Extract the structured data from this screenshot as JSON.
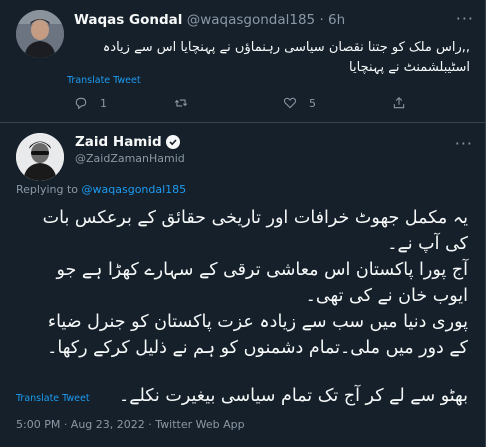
{
  "reply_tweet": {
    "name": "Waqas Gondal",
    "handle": "@waqasgondal185",
    "time": "· 6h",
    "text_line1": ",,راس ملک کو جتنا نقصان سیاسی رہنماؤں نے پہنچایا اس سے زیادہ",
    "text_line2": "اسٹیبلشمنٹ نے پہنچایا",
    "translate_label": "Translate Tweet",
    "reply_count": "1",
    "retweet_count": "",
    "like_count": "5",
    "more_icon": "more-dots"
  },
  "main_tweet": {
    "name": "Zaid Hamid",
    "handle": "@ZaidZamanHamid",
    "verified": true,
    "replying_prefix": "Replying to",
    "replying_to": "@waqasgondal185",
    "lines": [
      "یہ مکمل جھوٹ خرافات اور تاریخی حقائق کے برعکس بات",
      "کی آپ نے۔",
      "آج پورا پاکستان اس معاشی ترقی کے سہارے کھڑا ہے جو",
      "ایوب خان نے کی تھی۔",
      "پوری دنیا میں سب سے زیادہ عزت پاکستان کو جنرل ضیاء",
      "کے دور میں ملی۔تمام دشمنوں کو ہم نے ذلیل کرکے رکھا۔",
      "",
      "بھٹو سے لے کر آج تک تمام  سیاسی بیغیرت نکلے۔"
    ],
    "translate_label": "Translate Tweet",
    "timestamp": "5:00 PM · Aug 23, 2022 · Twitter Web App"
  },
  "colors": {
    "background": "#15202b",
    "border": "#38444d",
    "text": "#f7f9f9",
    "muted": "#8b98a5",
    "link": "#1d9bf0"
  }
}
